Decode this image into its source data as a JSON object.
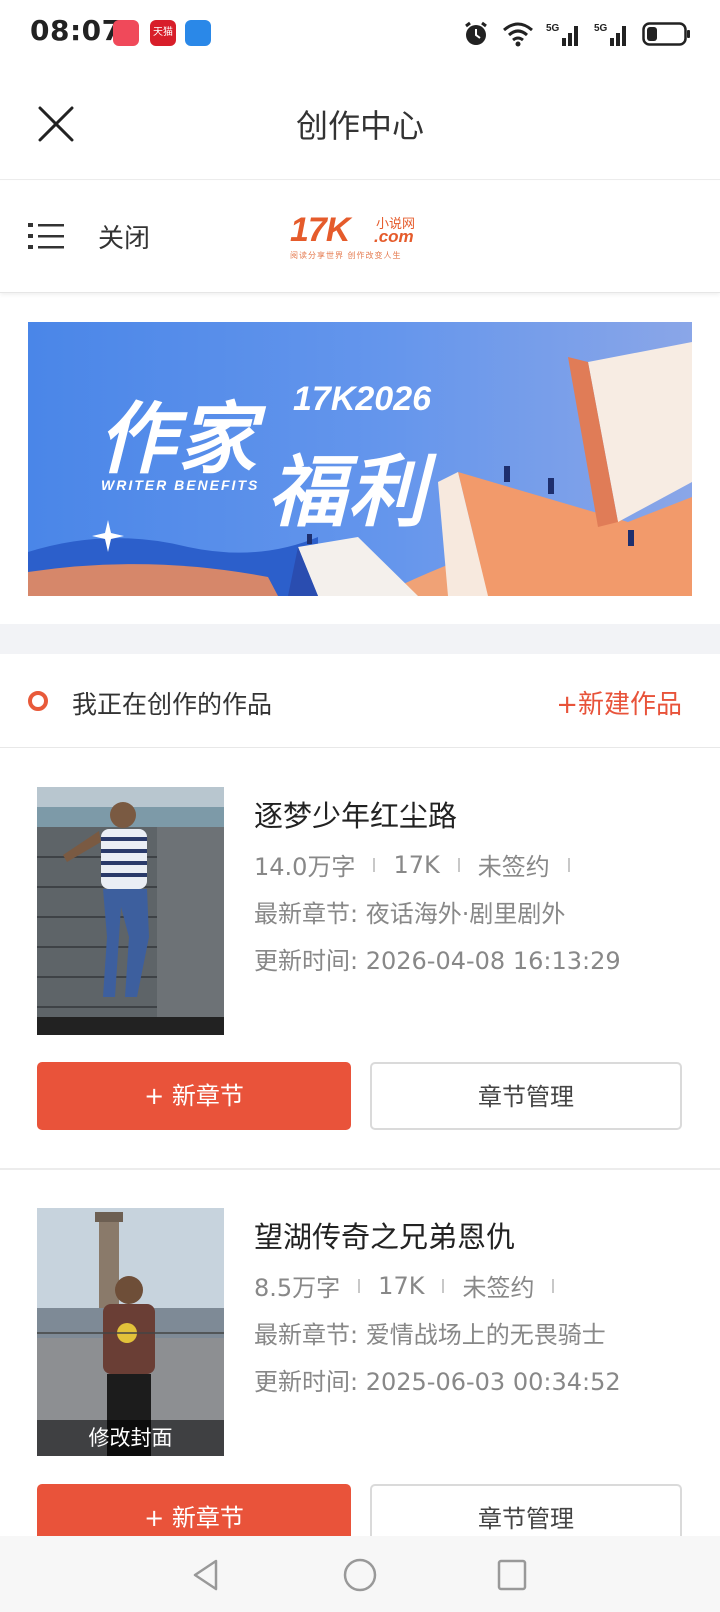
{
  "status_bar": {
    "time": "08:07",
    "app_icons": [
      "message-app-icon",
      "tmall-icon",
      "weather-icon"
    ],
    "tmall_text": "天猫",
    "signal1": "5G",
    "signal2": "5G"
  },
  "titlebar": {
    "title": "创作中心"
  },
  "site_header": {
    "close_label": "关闭",
    "logo_main": "17K",
    "logo_sub": "小说网",
    "logo_domain": ".com",
    "logo_tagline": "阅读分享世界  创作改变人生"
  },
  "banner": {
    "line1": "作家",
    "line2": "福利",
    "year": "17K2026",
    "english": "WRITER BENEFITS"
  },
  "section": {
    "label": "我正在创作的作品",
    "new_work": "+新建作品"
  },
  "works": [
    {
      "title": "逐梦少年红尘路",
      "word_count": "14.0万字",
      "site": "17K",
      "sign_status": "未签约",
      "latest_chapter": "最新章节: 夜话海外·剧里剧外",
      "updated": "更新时间: 2026-04-08 16:13:29",
      "new_chapter_label": "+ 新章节",
      "manage_label": "章节管理"
    },
    {
      "title": "望湖传奇之兄弟恩仇",
      "word_count": "8.5万字",
      "site": "17K",
      "sign_status": "未签约",
      "latest_chapter": "最新章节: 爱情战场上的无畏骑士",
      "updated": "更新时间: 2025-06-03 00:34:52",
      "cover_label": "修改封面",
      "new_chapter_label": "+ 新章节",
      "manage_label": "章节管理"
    }
  ],
  "colors": {
    "accent": "#e9533a",
    "banner_blue": "#4a86e8",
    "logo_orange": "#e55b2b"
  }
}
